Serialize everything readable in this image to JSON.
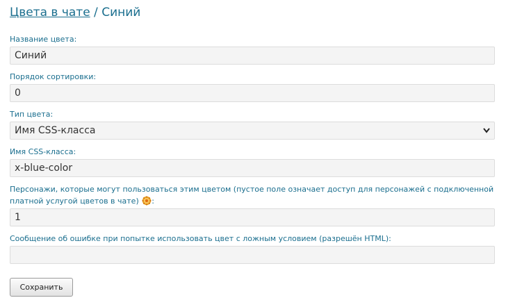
{
  "breadcrumb": {
    "parent_link": "Цвета в чате",
    "separator": " / ",
    "current": "Синий"
  },
  "fields": {
    "color_name": {
      "label": "Название цвета:",
      "value": "Синий"
    },
    "sort_order": {
      "label": "Порядок сортировки:",
      "value": "0"
    },
    "color_type": {
      "label": "Тип цвета:",
      "value": "Имя CSS-класса"
    },
    "css_class": {
      "label": "Имя CSS-класса:",
      "value": "x-blue-color"
    },
    "characters": {
      "label": "Персонажи, которые могут пользоваться этим цветом (пустое поле означает доступ для персонажей с подключенной платной услугой цветов в чате)",
      "label_suffix": ":",
      "help_icon": "help-gear-icon",
      "value": "1"
    },
    "error_message": {
      "label": "Сообщение об ошибке при попытке использовать цвет с ложным условием (разрешён HTML):",
      "value": ""
    }
  },
  "actions": {
    "save_label": "Сохранить"
  },
  "colors": {
    "accent": "#1a6e8e",
    "field_bg": "#f4f4f4",
    "help_icon": "#e8a020"
  }
}
